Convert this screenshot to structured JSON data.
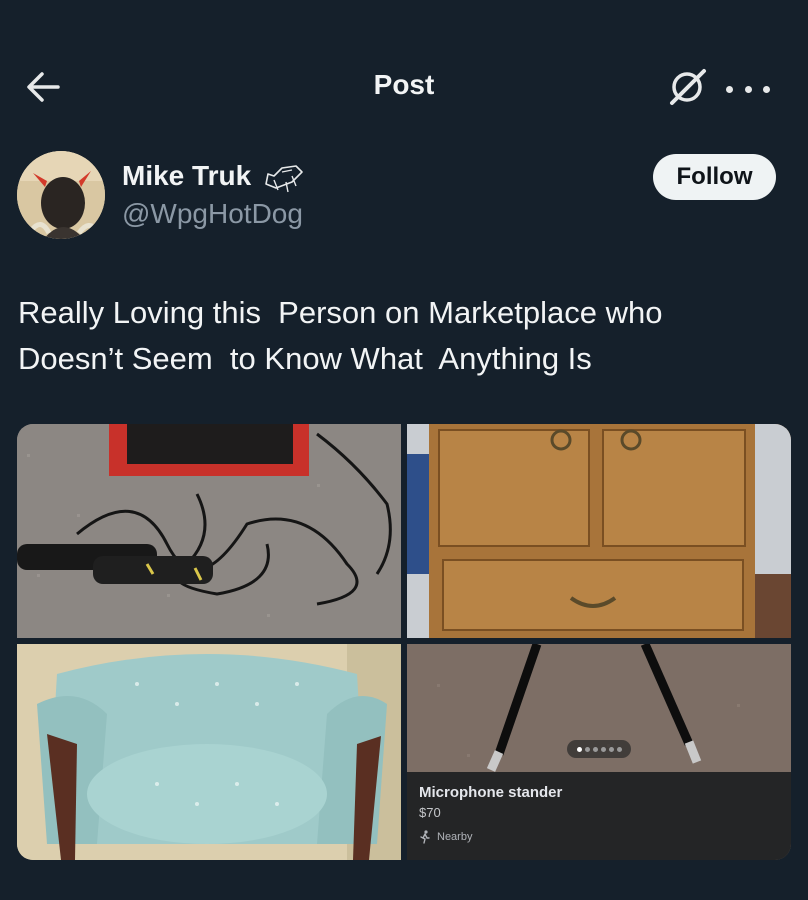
{
  "header": {
    "title": "Post",
    "back_icon": "arrow-left-icon",
    "grok_icon": "grok-icon",
    "more_icon": "more-horizontal-icon"
  },
  "author": {
    "name": "Mike Truk",
    "handle": "@WpgHotDog",
    "follow_label": "Follow"
  },
  "post": {
    "text": "Really Loving this  Person on Marketplace who\nDoesn’t Seem  to Know What  Anything Is"
  },
  "media": {
    "count": 4,
    "listing": {
      "title": "Microphone stander",
      "price": "$70",
      "nearby": "Nearby",
      "pager_dots": 6,
      "pager_active": 0
    }
  },
  "colors": {
    "background": "#15202b",
    "text": "#e7e9ea",
    "secondary": "#8b98a5",
    "follow_bg": "#eff3f4"
  }
}
